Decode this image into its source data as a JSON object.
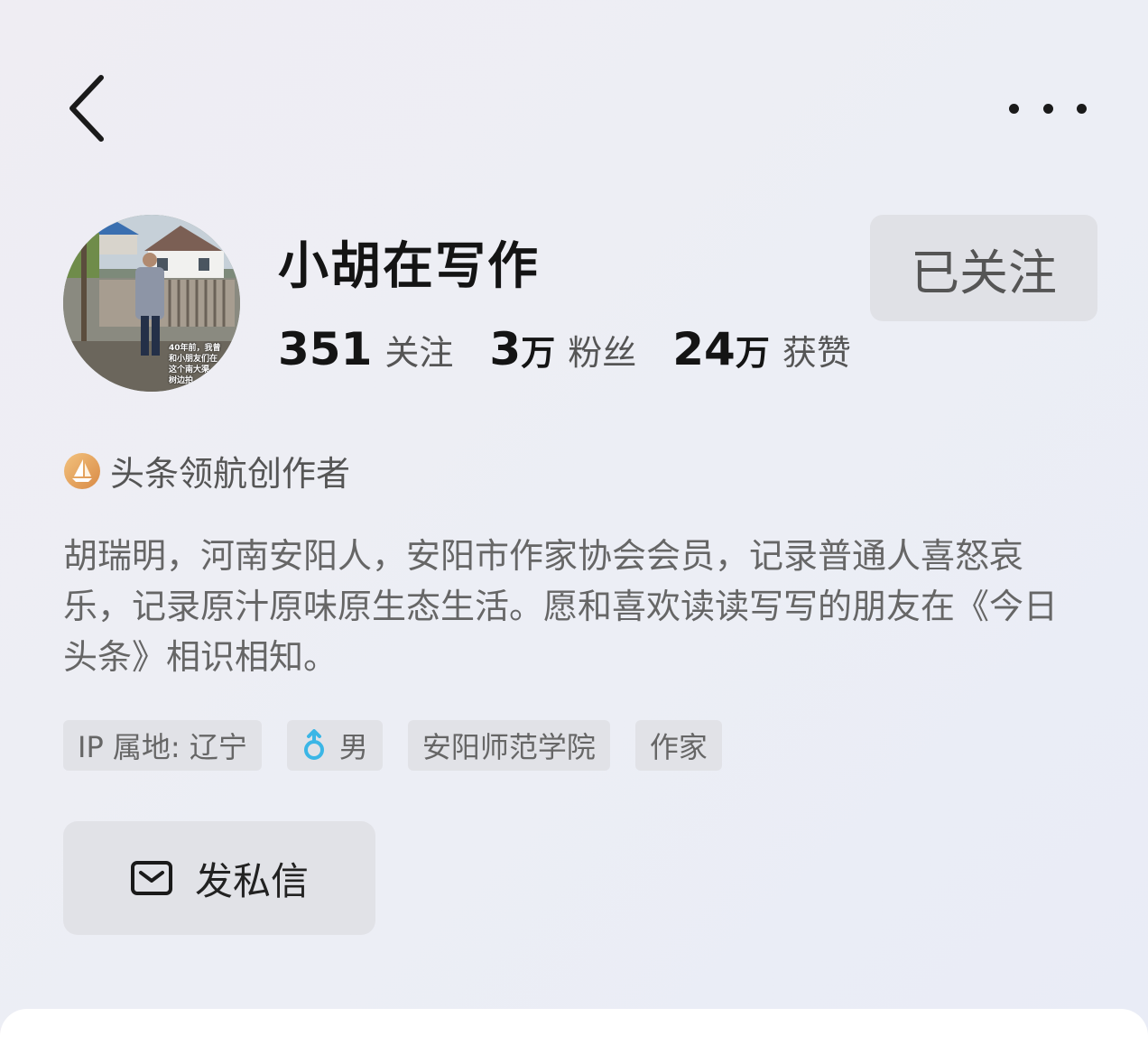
{
  "header": {
    "back_icon": "chevron-left-icon",
    "more_icon": "more-dots-icon"
  },
  "profile": {
    "username": "小胡在写作",
    "avatar_caption": "40年前，我曾\n和小朋友们在\n这个南大渠\n树边拍",
    "follow_button_label": "已关注",
    "stats": [
      {
        "num": "351",
        "unit": "",
        "label": "关注"
      },
      {
        "num": "3",
        "unit": "万",
        "label": "粉丝"
      },
      {
        "num": "24",
        "unit": "万",
        "label": "获赞"
      }
    ],
    "badge": {
      "icon": "sailboat-badge-icon",
      "label": "头条领航创作者"
    },
    "bio": "胡瑞明，河南安阳人，安阳市作家协会会员，记录普通人喜怒哀乐，记录原汁原味原生态生活。愿和喜欢读读写写的朋友在《今日头条》相识相知。",
    "tags": {
      "ip": "IP 属地: 辽宁",
      "gender": "男",
      "school": "安阳师范学院",
      "job": "作家"
    },
    "message_button_label": "发私信"
  },
  "colors": {
    "background": "#eceef5",
    "button_bg": "#e1e2e7",
    "gender_icon": "#3bb6e6",
    "badge_gold": "#e4a25a"
  }
}
